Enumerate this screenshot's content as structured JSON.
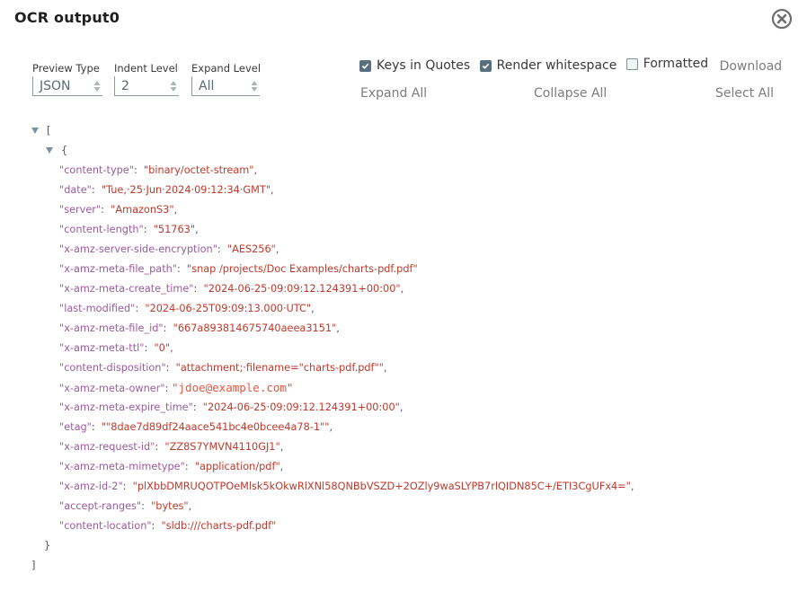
{
  "dialog": {
    "title": "OCR output0",
    "close_icon": "close-circle-icon"
  },
  "controls": {
    "preview_type": {
      "label": "Preview Type",
      "value": "JSON"
    },
    "indent_level": {
      "label": "Indent Level",
      "value": "2"
    },
    "expand_level": {
      "label": "Expand Level",
      "value": "All"
    }
  },
  "options": {
    "keys_in_quotes": {
      "label": "Keys in Quotes",
      "checked": true
    },
    "render_whitespace": {
      "label": "Render whitespace",
      "checked": true
    },
    "formatted": {
      "label": "Formatted",
      "checked": false
    },
    "download": "Download",
    "expand_all": "Expand All",
    "collapse_all": "Collapse All",
    "select_all": "Select All"
  },
  "json_tree": {
    "open_array": "[",
    "open_object": "{",
    "close_object": "}",
    "close_array": "]",
    "entries": [
      {
        "key": "\"content-type\"",
        "value": "\"binary/octet-stream\"",
        "comma": ","
      },
      {
        "key": "\"date\"",
        "value": "\"Tue,·25·Jun·2024·09:12:34·GMT\"",
        "comma": ","
      },
      {
        "key": "\"server\"",
        "value": "\"AmazonS3\"",
        "comma": ","
      },
      {
        "key": "\"content-length\"",
        "value": "\"51763\"",
        "comma": ","
      },
      {
        "key": "\"x-amz-server-side-encryption\"",
        "value": "\"AES256\"",
        "comma": ","
      },
      {
        "key": "\"x-amz-meta-file_path\"",
        "value": "\"snap /projects/Doc Examples/charts-pdf.pdf\"",
        "comma": ""
      },
      {
        "key": "\"x-amz-meta-create_time\"",
        "value": "\"2024-06-25·09:09:12.124391+00:00\"",
        "comma": ","
      },
      {
        "key": "\"last-modified\"",
        "value": "\"2024-06-25T09:09:13.000·UTC\"",
        "comma": ","
      },
      {
        "key": "\"x-amz-meta-file_id\"",
        "value": "\"667a893814675740aeea3151\"",
        "comma": ","
      },
      {
        "key": "\"x-amz-meta-ttl\"",
        "value": "\"0\"",
        "comma": ","
      },
      {
        "key": "\"content-disposition\"",
        "value": "\"attachment;·filename=\"charts-pdf.pdf\"\"",
        "comma": ","
      },
      {
        "key": "\"x-amz-meta-owner\"",
        "value": "\"jdoe@example.com\"",
        "comma": ""
      },
      {
        "key": "\"x-amz-meta-expire_time\"",
        "value": "\"2024-06-25·09:09:12.124391+00:00\"",
        "comma": ","
      },
      {
        "key": "\"etag\"",
        "value": "\"\"8dae7d89df24aace541bc4e0bcee4a78-1\"\"",
        "comma": ","
      },
      {
        "key": "\"x-amz-request-id\"",
        "value": "\"ZZ8S7YMVN4110GJ1\"",
        "comma": ","
      },
      {
        "key": "\"x-amz-meta-mimetype\"",
        "value": "\"application/pdf\"",
        "comma": ","
      },
      {
        "key": "\"x-amz-id-2\"",
        "value": "\"plXbbDMRUQOTPOeMlsk5kOkwRlXNl58QNBbVSZD+2OZly9waSLYPB7rlQIDN85C+/ETI3CgUFx4=\"",
        "comma": ","
      },
      {
        "key": "\"accept-ranges\"",
        "value": "\"bytes\"",
        "comma": ","
      },
      {
        "key": "\"content-location\"",
        "value": "\"sldb:///charts-pdf.pdf\"",
        "comma": ""
      }
    ]
  },
  "colors": {
    "key": "#9a5b9e",
    "value": "#c0392b",
    "checkbox": "#5a6f7c"
  }
}
